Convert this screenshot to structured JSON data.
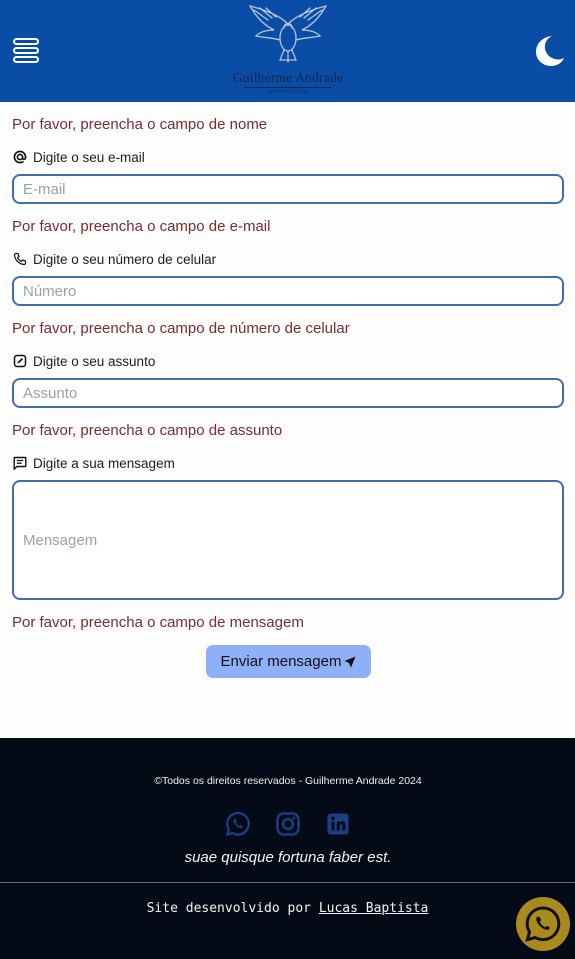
{
  "header": {
    "logo_name": "Guilherme Andrade",
    "logo_subtitle": "ADVOCACIA",
    "menu_icon": "menu-icon",
    "theme_icon": "moon-icon"
  },
  "form": {
    "name_error": "Por favor, preencha o campo de nome",
    "email_label": "Digite o seu e-mail",
    "email_placeholder": "E-mail",
    "email_error": "Por favor, preencha o campo de e-mail",
    "phone_label": "Digite o seu número de celular",
    "phone_placeholder": "Número",
    "phone_error": "Por favor, preencha o campo de número de celular",
    "subject_label": "Digite o seu assunto",
    "subject_placeholder": "Assunto",
    "subject_error": "Por favor, preencha o campo de assunto",
    "message_label": "Digite a sua mensagem",
    "message_placeholder": "Mensagem",
    "message_error": "Por favor, preencha o campo de mensagem",
    "submit_label": "Enviar mensagem"
  },
  "footer": {
    "copyright": "©Todos os direitos reservados - Guilherme Andrade 2024",
    "social_icons": [
      "whatsapp-icon",
      "instagram-icon",
      "linkedin-icon"
    ],
    "motto": "suae quisque fortuna faber est.",
    "credit_prefix": "Site desenvolvido por",
    "credit_link": "Lucas Baptista"
  },
  "colors": {
    "header_bg": "#0a4da6",
    "error_text": "#7a2d2d",
    "input_border": "#3d6fb0",
    "button_bg": "#8fb0f7",
    "footer_bg": "#040a16",
    "social_icon": "#1a3f86",
    "whatsapp_float": "#a98a1e"
  }
}
